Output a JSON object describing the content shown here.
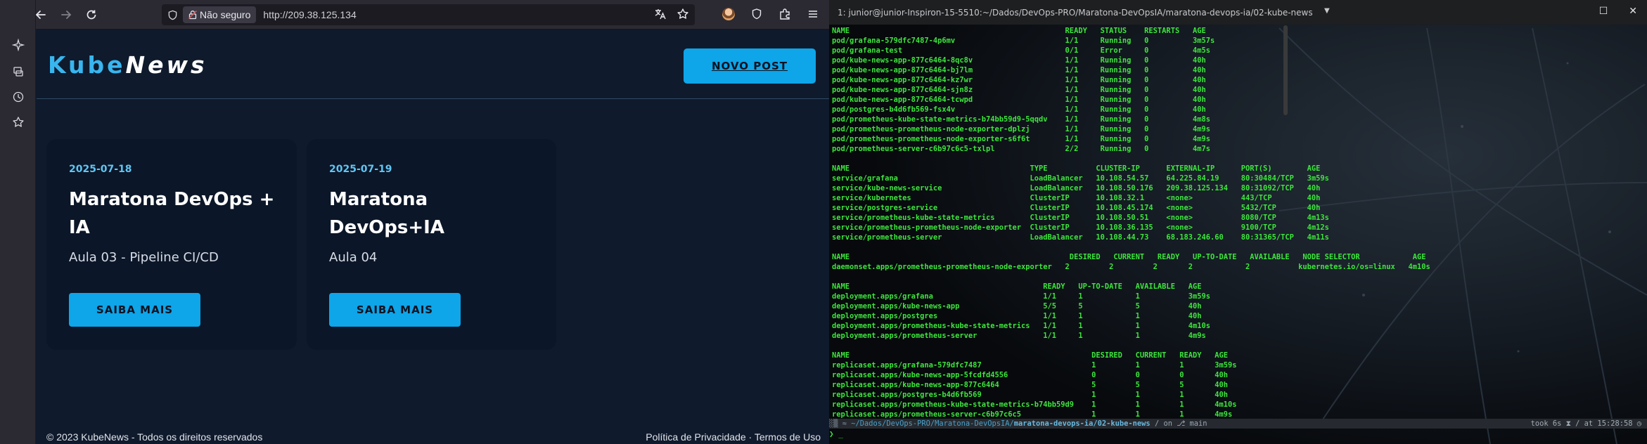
{
  "browser": {
    "url_insecure_label": "Não seguro",
    "url": "http://209.38.125.134",
    "site": {
      "logo_part1": "Kube",
      "logo_part2": "News",
      "new_post_label": "NOVO POST",
      "posts": [
        {
          "date": "2025-07-18",
          "title": "Maratona DevOps + IA",
          "subtitle": "Aula 03 - Pipeline CI/CD",
          "button": "SAIBA MAIS"
        },
        {
          "date": "2025-07-19",
          "title": "Maratona DevOps+IA",
          "subtitle": "Aula 04",
          "button": "SAIBA MAIS"
        }
      ],
      "footer_left": "© 2023 KubeNews - Todos os direitos reservados",
      "footer_right": "Política de Privacidade · Termos de Uso"
    }
  },
  "terminal": {
    "title": "1: junior@junior-Inspiron-15-5510:~/Dados/DevOps-PRO/Maratona-DevOpsIA/maratona-devops-ia/02-kube-news",
    "output_lines": [
      "NAME                                                 READY   STATUS    RESTARTS   AGE",
      "pod/grafana-579dfc7487-4p6mv                         1/1     Running   0          3m57s",
      "pod/grafana-test                                     0/1     Error     0          4m5s",
      "pod/kube-news-app-877c6464-8qc8v                     1/1     Running   0          40h",
      "pod/kube-news-app-877c6464-bj7lm                     1/1     Running   0          40h",
      "pod/kube-news-app-877c6464-kz7wr                     1/1     Running   0          40h",
      "pod/kube-news-app-877c6464-sjn8z                     1/1     Running   0          40h",
      "pod/kube-news-app-877c6464-tcwpd                     1/1     Running   0          40h",
      "pod/postgres-b4d6fb569-fsx4v                         1/1     Running   0          40h",
      "pod/prometheus-kube-state-metrics-b74bb59d9-5qqdv    1/1     Running   0          4m8s",
      "pod/prometheus-prometheus-node-exporter-dplzj        1/1     Running   0          4m9s",
      "pod/prometheus-prometheus-node-exporter-s6f6t        1/1     Running   0          4m9s",
      "pod/prometheus-server-c6b97c6c5-txlpl                2/2     Running   0          4m7s",
      "",
      "NAME                                         TYPE           CLUSTER-IP      EXTERNAL-IP      PORT(S)        AGE",
      "service/grafana                              LoadBalancer   10.108.54.57    64.225.84.19     80:30484/TCP   3m59s",
      "service/kube-news-service                    LoadBalancer   10.108.50.176   209.38.125.134   80:31092/TCP   40h",
      "service/kubernetes                           ClusterIP      10.108.32.1     <none>           443/TCP        40h",
      "service/postgres-service                     ClusterIP      10.108.45.174   <none>           5432/TCP       40h",
      "service/prometheus-kube-state-metrics        ClusterIP      10.108.50.51    <none>           8080/TCP       4m13s",
      "service/prometheus-prometheus-node-exporter  ClusterIP      10.108.36.135   <none>           9100/TCP       4m12s",
      "service/prometheus-server                    LoadBalancer   10.108.44.73    68.183.246.60    80:31365/TCP   4m11s",
      "",
      "NAME                                                  DESIRED   CURRENT   READY   UP-TO-DATE   AVAILABLE   NODE SELECTOR            AGE",
      "daemonset.apps/prometheus-prometheus-node-exporter   2         2         2       2            2           kubernetes.io/os=linux   4m10s",
      "",
      "NAME                                            READY   UP-TO-DATE   AVAILABLE   AGE",
      "deployment.apps/grafana                         1/1     1            1           3m59s",
      "deployment.apps/kube-news-app                   5/5     5            5           40h",
      "deployment.apps/postgres                        1/1     1            1           40h",
      "deployment.apps/prometheus-kube-state-metrics   1/1     1            1           4m10s",
      "deployment.apps/prometheus-server               1/1     1            1           4m9s",
      "",
      "NAME                                                       DESIRED   CURRENT   READY   AGE",
      "replicaset.apps/grafana-579dfc7487                         1         1         1       3m59s",
      "replicaset.apps/kube-news-app-5fcdfd4556                   0         0         0       40h",
      "replicaset.apps/kube-news-app-877c6464                     5         5         5       40h",
      "replicaset.apps/postgres-b4d6fb569                         1         1         1       40h",
      "replicaset.apps/prometheus-kube-state-metrics-b74bb59d9    1         1         1       4m10s",
      "replicaset.apps/prometheus-server-c6b97c6c5                1         1         1       4m9s"
    ],
    "prompt": {
      "prefix": "░▒ ≈ ",
      "path_dim": "~/Dados/DevOps-PRO/Maratona-DevOpsIA/",
      "path_bold": "maratona-devops-ia/02-kube-news",
      "branch": " / on ⎇ main",
      "right": "took 6s ⧗ / at 15:28:58 ◷"
    },
    "cursor": "❯ _"
  }
}
